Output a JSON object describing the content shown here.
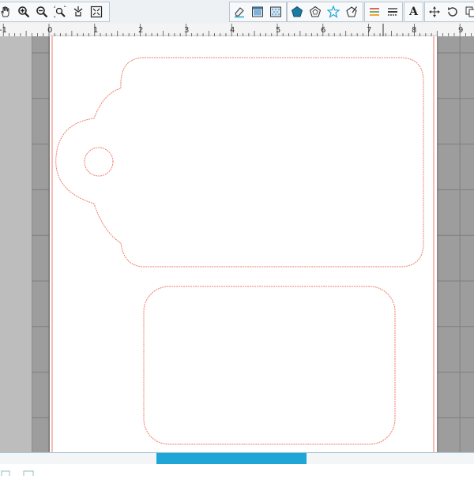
{
  "toolbar": {
    "groups": [
      {
        "name": "view-tools",
        "tools": [
          "pan-hand-icon",
          "zoom-in-icon",
          "zoom-out-icon",
          "zoom-selection-icon",
          "fit-page-icon",
          "fit-window-icon"
        ]
      },
      {
        "name": "eraser-fill",
        "tools": [
          "eraser-icon",
          "fill-window-icon",
          "pattern-fill-icon"
        ]
      },
      {
        "name": "shapes",
        "tools": [
          "pentagon-filled-icon",
          "pentagon-outline-icon",
          "star-outline-icon",
          "polygon-draw-icon"
        ]
      },
      {
        "name": "lines",
        "tools": [
          "line-color-icon",
          "line-style-icon"
        ]
      },
      {
        "name": "text",
        "tools": [
          "text-tool-icon"
        ],
        "label": "A"
      },
      {
        "name": "transform",
        "tools": [
          "move-arrows-icon",
          "rotate-icon",
          "replicate-icon"
        ]
      }
    ]
  },
  "ruler": {
    "labels": [
      "-1",
      "0",
      "1",
      "2",
      "3",
      "4",
      "5",
      "6",
      "7",
      "8",
      "9"
    ]
  },
  "colors": {
    "cut_line": "#f07a6a",
    "accent": "#1ea7d6",
    "page": "#ffffff",
    "mat": "#9d9d9d"
  },
  "scrollbar": {
    "horizontal_position": 0.33
  }
}
